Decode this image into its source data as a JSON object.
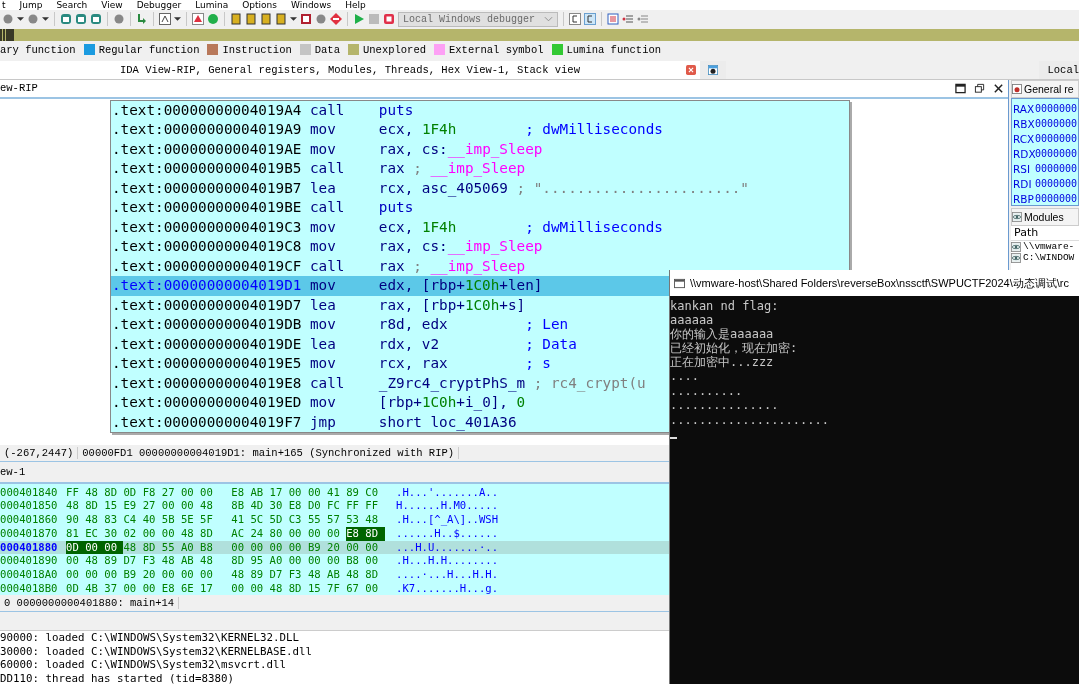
{
  "menu": [
    "t",
    "Jump",
    "Search",
    "View",
    "Debugger",
    "Lumina",
    "Options",
    "Windows",
    "Help"
  ],
  "toolbar": {
    "debugger_select": {
      "value": "Local Windows debugger",
      "disabled": true
    }
  },
  "legend": [
    {
      "label": "ary function"
    },
    {
      "label": "Regular function",
      "color": "#1b9be0"
    },
    {
      "label": "Instruction",
      "color": "#b8785a"
    },
    {
      "label": "Data",
      "color": "#c4c4c4"
    },
    {
      "label": "Unexplored",
      "color": "#b5b56b"
    },
    {
      "label": "External symbol",
      "color": "#fda0f5"
    },
    {
      "label": "Lumina function",
      "color": "#33c933"
    }
  ],
  "tabs": [
    {
      "label": "IDA View-RIP, General registers, Modules, Threads, Hex View-1, Stack view",
      "selected": true,
      "closable": true
    },
    {
      "selected": false,
      "closable": false
    },
    {
      "label": "Local",
      "selected": false,
      "closable": false
    }
  ],
  "ida_view": {
    "title": "ew-RIP",
    "lines": [
      {
        "address": ".text:00000000004019A4",
        "mnemonic": "call",
        "operands": [
          {
            "text": "puts",
            "kind": "name"
          }
        ],
        "selected": false
      },
      {
        "address": ".text:00000000004019A9",
        "mnemonic": "mov",
        "operands": [
          {
            "text": "ecx, ",
            "kind": "plain"
          },
          {
            "text": "1F4h",
            "kind": "number"
          }
        ],
        "comment_aligned": true,
        "comment": [
          {
            "text": "; dwMilliseconds",
            "kind": "auto"
          }
        ],
        "selected": false
      },
      {
        "address": ".text:00000000004019AE",
        "mnemonic": "mov",
        "operands": [
          {
            "text": "rax, cs:",
            "kind": "plain"
          },
          {
            "text": "__imp_Sleep",
            "kind": "import"
          }
        ],
        "selected": false
      },
      {
        "address": ".text:00000000004019B5",
        "mnemonic": "call",
        "operands": [
          {
            "text": "rax",
            "kind": "plain"
          }
        ],
        "comment_aligned": false,
        "comment": [
          {
            "text": ";",
            "kind": "gray"
          },
          {
            "text": "__imp_Sleep",
            "kind": "import"
          }
        ],
        "selected": false
      },
      {
        "address": ".text:00000000004019B7",
        "mnemonic": "lea",
        "operands": [
          {
            "text": "rcx, asc_405069",
            "kind": "plain"
          }
        ],
        "comment_aligned": false,
        "comment": [
          {
            "text": "; \".......................\"",
            "kind": "gray"
          }
        ],
        "selected": false
      },
      {
        "address": ".text:00000000004019BE",
        "mnemonic": "call",
        "operands": [
          {
            "text": "puts",
            "kind": "name"
          }
        ],
        "selected": false
      },
      {
        "address": ".text:00000000004019C3",
        "mnemonic": "mov",
        "operands": [
          {
            "text": "ecx, ",
            "kind": "plain"
          },
          {
            "text": "1F4h",
            "kind": "number"
          }
        ],
        "comment_aligned": true,
        "comment": [
          {
            "text": "; dwMilliseconds",
            "kind": "auto"
          }
        ],
        "selected": false
      },
      {
        "address": ".text:00000000004019C8",
        "mnemonic": "mov",
        "operands": [
          {
            "text": "rax, cs:",
            "kind": "plain"
          },
          {
            "text": "__imp_Sleep",
            "kind": "import"
          }
        ],
        "selected": false
      },
      {
        "address": ".text:00000000004019CF",
        "mnemonic": "call",
        "operands": [
          {
            "text": "rax",
            "kind": "plain"
          }
        ],
        "comment_aligned": false,
        "comment": [
          {
            "text": ";",
            "kind": "gray"
          },
          {
            "text": "__imp_Sleep",
            "kind": "import"
          }
        ],
        "selected": false
      },
      {
        "address": ".text:00000000004019D1",
        "mnemonic": "mov",
        "operands": [
          {
            "text": "edx, [rbp+",
            "kind": "plain"
          },
          {
            "text": "1C0h",
            "kind": "number"
          },
          {
            "text": "+len]",
            "kind": "plain"
          }
        ],
        "selected": true
      },
      {
        "address": ".text:00000000004019D7",
        "mnemonic": "lea",
        "operands": [
          {
            "text": "rax, [rbp+",
            "kind": "plain"
          },
          {
            "text": "1C0h",
            "kind": "number"
          },
          {
            "text": "+s]",
            "kind": "plain"
          }
        ],
        "selected": false
      },
      {
        "address": ".text:00000000004019DB",
        "mnemonic": "mov",
        "operands": [
          {
            "text": "r8d, edx",
            "kind": "plain"
          }
        ],
        "comment_aligned": true,
        "comment": [
          {
            "text": "; Len",
            "kind": "auto"
          }
        ],
        "selected": false
      },
      {
        "address": ".text:00000000004019DE",
        "mnemonic": "lea",
        "operands": [
          {
            "text": "rdx, v2",
            "kind": "plain"
          }
        ],
        "comment_aligned": true,
        "comment": [
          {
            "text": "; Data",
            "kind": "auto"
          }
        ],
        "selected": false
      },
      {
        "address": ".text:00000000004019E5",
        "mnemonic": "mov",
        "operands": [
          {
            "text": "rcx, rax",
            "kind": "plain"
          }
        ],
        "comment_aligned": true,
        "comment": [
          {
            "text": "; s",
            "kind": "auto"
          }
        ],
        "selected": false
      },
      {
        "address": ".text:00000000004019E8",
        "mnemonic": "call",
        "operands": [
          {
            "text": "_Z9rc4_cryptPhS_m",
            "kind": "plain"
          }
        ],
        "comment_aligned": false,
        "comment": [
          {
            "text": "; rc4_crypt(u",
            "kind": "gray"
          }
        ],
        "selected": false
      },
      {
        "address": ".text:00000000004019ED",
        "mnemonic": "mov",
        "operands": [
          {
            "text": "[rbp+",
            "kind": "plain"
          },
          {
            "text": "1C0h",
            "kind": "number"
          },
          {
            "text": "+i_0], ",
            "kind": "plain"
          },
          {
            "text": "0",
            "kind": "number"
          }
        ],
        "selected": false
      },
      {
        "address": ".text:00000000004019F7",
        "mnemonic": "jmp",
        "operands": [
          {
            "text": "short loc_401A36",
            "kind": "plain"
          }
        ],
        "selected": false
      }
    ],
    "status": [
      "(-267,2447)",
      "00000FD1 00000000004019D1: main+165 (Synchronized with RIP)"
    ]
  },
  "hex_view": {
    "title": "ew-1",
    "rows": [
      {
        "address": "000401840",
        "selected": false,
        "ascii": ".H...'.......A..",
        "bytes": [
          {
            "v": "FF",
            "selected": false
          },
          {
            "v": "48",
            "selected": false
          },
          {
            "v": "8D",
            "selected": false
          },
          {
            "v": "0D",
            "selected": false
          },
          {
            "v": "F8",
            "selected": false
          },
          {
            "v": "27",
            "selected": false
          },
          {
            "v": "00",
            "selected": false
          },
          {
            "v": "00",
            "selected": false
          },
          {
            "v": "E8",
            "selected": false
          },
          {
            "v": "AB",
            "selected": false
          },
          {
            "v": "17",
            "selected": false
          },
          {
            "v": "00",
            "selected": false
          },
          {
            "v": "00",
            "selected": false
          },
          {
            "v": "41",
            "selected": false
          },
          {
            "v": "89",
            "selected": false
          },
          {
            "v": "C0",
            "selected": false
          }
        ]
      },
      {
        "address": "000401850",
        "selected": false,
        "ascii": "H......H.M0.....",
        "bytes": [
          {
            "v": "48",
            "selected": false
          },
          {
            "v": "8D",
            "selected": false
          },
          {
            "v": "15",
            "selected": false
          },
          {
            "v": "E9",
            "selected": false
          },
          {
            "v": "27",
            "selected": false
          },
          {
            "v": "00",
            "selected": false
          },
          {
            "v": "00",
            "selected": false
          },
          {
            "v": "48",
            "selected": false
          },
          {
            "v": "8B",
            "selected": false
          },
          {
            "v": "4D",
            "selected": false
          },
          {
            "v": "30",
            "selected": false
          },
          {
            "v": "E8",
            "selected": false
          },
          {
            "v": "D0",
            "selected": false
          },
          {
            "v": "FC",
            "selected": false
          },
          {
            "v": "FF",
            "selected": false
          },
          {
            "v": "FF",
            "selected": false
          }
        ]
      },
      {
        "address": "000401860",
        "selected": false,
        "ascii": ".H...[^_A\\]..WSH",
        "bytes": [
          {
            "v": "90",
            "selected": false
          },
          {
            "v": "48",
            "selected": false
          },
          {
            "v": "83",
            "selected": false
          },
          {
            "v": "C4",
            "selected": false
          },
          {
            "v": "40",
            "selected": false
          },
          {
            "v": "5B",
            "selected": false
          },
          {
            "v": "5E",
            "selected": false
          },
          {
            "v": "5F",
            "selected": false
          },
          {
            "v": "41",
            "selected": false
          },
          {
            "v": "5C",
            "selected": false
          },
          {
            "v": "5D",
            "selected": false
          },
          {
            "v": "C3",
            "selected": false
          },
          {
            "v": "55",
            "selected": false
          },
          {
            "v": "57",
            "selected": false
          },
          {
            "v": "53",
            "selected": false
          },
          {
            "v": "48",
            "selected": false
          }
        ]
      },
      {
        "address": "000401870",
        "selected": false,
        "ascii": "......H..$......",
        "bytes": [
          {
            "v": "81",
            "selected": false
          },
          {
            "v": "EC",
            "selected": false
          },
          {
            "v": "30",
            "selected": false
          },
          {
            "v": "02",
            "selected": false
          },
          {
            "v": "00",
            "selected": false
          },
          {
            "v": "00",
            "selected": false
          },
          {
            "v": "48",
            "selected": false
          },
          {
            "v": "8D",
            "selected": false
          },
          {
            "v": "AC",
            "selected": false
          },
          {
            "v": "24",
            "selected": false
          },
          {
            "v": "80",
            "selected": false
          },
          {
            "v": "00",
            "selected": false
          },
          {
            "v": "00",
            "selected": false
          },
          {
            "v": "00",
            "selected": false
          },
          {
            "v": "E8",
            "selected": true
          },
          {
            "v": "8D",
            "selected": true
          }
        ]
      },
      {
        "address": "000401880",
        "selected": true,
        "ascii": "...H.U.......·..",
        "bytes": [
          {
            "v": "0D",
            "selected": true
          },
          {
            "v": "00",
            "selected": true
          },
          {
            "v": "00",
            "selected": true
          },
          {
            "v": "48",
            "selected": false
          },
          {
            "v": "8D",
            "selected": false
          },
          {
            "v": "55",
            "selected": false
          },
          {
            "v": "A0",
            "selected": false
          },
          {
            "v": "B8",
            "selected": false
          },
          {
            "v": "00",
            "selected": false
          },
          {
            "v": "00",
            "selected": false
          },
          {
            "v": "00",
            "selected": false
          },
          {
            "v": "00",
            "selected": false
          },
          {
            "v": "B9",
            "selected": false
          },
          {
            "v": "20",
            "selected": false
          },
          {
            "v": "00",
            "selected": false
          },
          {
            "v": "00",
            "selected": false
          }
        ]
      },
      {
        "address": "000401890",
        "selected": false,
        "ascii": ".H...H.H........",
        "bytes": [
          {
            "v": "00",
            "selected": false
          },
          {
            "v": "48",
            "selected": false
          },
          {
            "v": "89",
            "selected": false
          },
          {
            "v": "D7",
            "selected": false
          },
          {
            "v": "F3",
            "selected": false
          },
          {
            "v": "48",
            "selected": false
          },
          {
            "v": "AB",
            "selected": false
          },
          {
            "v": "48",
            "selected": false
          },
          {
            "v": "8D",
            "selected": false
          },
          {
            "v": "95",
            "selected": false
          },
          {
            "v": "A0",
            "selected": false
          },
          {
            "v": "00",
            "selected": false
          },
          {
            "v": "00",
            "selected": false
          },
          {
            "v": "00",
            "selected": false
          },
          {
            "v": "B8",
            "selected": false
          },
          {
            "v": "00",
            "selected": false
          }
        ]
      },
      {
        "address": "0004018A0",
        "selected": false,
        "ascii": "....·...H...H.H.",
        "bytes": [
          {
            "v": "00",
            "selected": false
          },
          {
            "v": "00",
            "selected": false
          },
          {
            "v": "00",
            "selected": false
          },
          {
            "v": "B9",
            "selected": false
          },
          {
            "v": "20",
            "selected": false
          },
          {
            "v": "00",
            "selected": false
          },
          {
            "v": "00",
            "selected": false
          },
          {
            "v": "00",
            "selected": false
          },
          {
            "v": "48",
            "selected": false
          },
          {
            "v": "89",
            "selected": false
          },
          {
            "v": "D7",
            "selected": false
          },
          {
            "v": "F3",
            "selected": false
          },
          {
            "v": "48",
            "selected": false
          },
          {
            "v": "AB",
            "selected": false
          },
          {
            "v": "48",
            "selected": false
          },
          {
            "v": "8D",
            "selected": false
          }
        ]
      },
      {
        "address": "0004018B0",
        "selected": false,
        "ascii": ".K7.......H...g.",
        "bytes": [
          {
            "v": "0D",
            "selected": false
          },
          {
            "v": "4B",
            "selected": false
          },
          {
            "v": "37",
            "selected": false
          },
          {
            "v": "00",
            "selected": false
          },
          {
            "v": "00",
            "selected": false
          },
          {
            "v": "E8",
            "selected": false
          },
          {
            "v": "6E",
            "selected": false
          },
          {
            "v": "17",
            "selected": false
          },
          {
            "v": "00",
            "selected": false
          },
          {
            "v": "00",
            "selected": false
          },
          {
            "v": "48",
            "selected": false
          },
          {
            "v": "8D",
            "selected": false
          },
          {
            "v": "15",
            "selected": false
          },
          {
            "v": "7F",
            "selected": false
          },
          {
            "v": "67",
            "selected": false
          },
          {
            "v": "00",
            "selected": false
          }
        ]
      }
    ],
    "status": "0 0000000000401880: main+14"
  },
  "output": [
    "90000: loaded C:\\WINDOWS\\System32\\KERNEL32.DLL",
    "30000: loaded C:\\WINDOWS\\System32\\KERNELBASE.dll",
    "60000: loaded C:\\WINDOWS\\System32\\msvcrt.dll",
    "DD110: thread has started (tid=8380)"
  ],
  "registers": {
    "title": "General re",
    "rows": [
      {
        "name": "RAX",
        "value": "0000000"
      },
      {
        "name": "RBX",
        "value": "0000000"
      },
      {
        "name": "RCX",
        "value": "0000000"
      },
      {
        "name": "RDX",
        "value": "0000000"
      },
      {
        "name": "RSI",
        "value": "0000000"
      },
      {
        "name": "RDI",
        "value": "0000000"
      },
      {
        "name": "RBP",
        "value": "0000000"
      }
    ]
  },
  "modules": {
    "title": "Modules",
    "column": "Path",
    "rows": [
      "\\\\vmware-",
      "C:\\WINDOW"
    ]
  },
  "console": {
    "title": "\\\\vmware-host\\Shared Folders\\reverseBox\\nssctf\\SWPUCTF2024\\动态调试\\rc",
    "lines": [
      "kankan nd flag:",
      "aaaaaa",
      "你的输入是aaaaaa",
      "已经初始化，现在加密:",
      "正在加密中...zzz",
      "....",
      "..........",
      "...............",
      "......................"
    ]
  }
}
